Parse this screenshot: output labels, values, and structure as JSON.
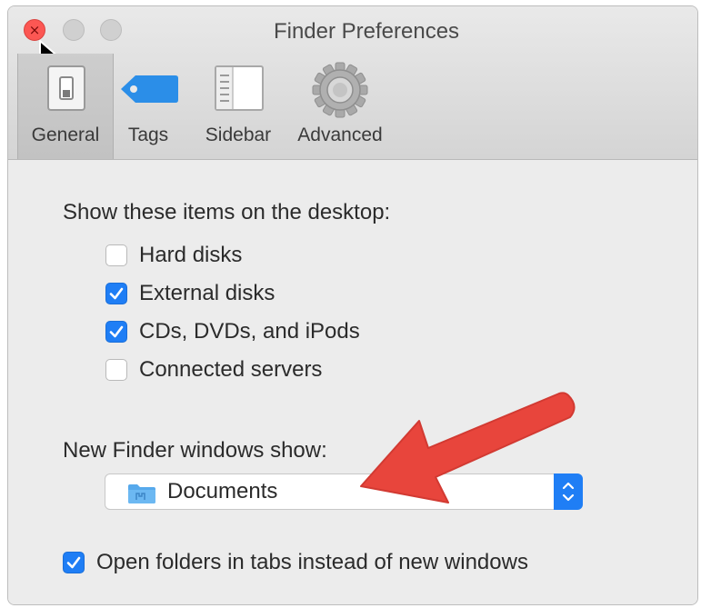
{
  "window": {
    "title": "Finder Preferences"
  },
  "toolbar": {
    "tabs": [
      {
        "label": "General",
        "icon": "switch-icon",
        "selected": true
      },
      {
        "label": "Tags",
        "icon": "tag-icon",
        "selected": false
      },
      {
        "label": "Sidebar",
        "icon": "sidebar-icon",
        "selected": false
      },
      {
        "label": "Advanced",
        "icon": "gear-icon",
        "selected": false
      }
    ]
  },
  "desktop": {
    "heading": "Show these items on the desktop:",
    "items": [
      {
        "label": "Hard disks",
        "checked": false
      },
      {
        "label": "External disks",
        "checked": true
      },
      {
        "label": "CDs, DVDs, and iPods",
        "checked": true
      },
      {
        "label": "Connected servers",
        "checked": false
      }
    ]
  },
  "new_window": {
    "heading": "New Finder windows show:",
    "selected": "Documents",
    "icon": "folder-icon"
  },
  "tabs_option": {
    "label": "Open folders in tabs instead of new windows",
    "checked": true
  },
  "colors": {
    "accent": "#1f7ef5",
    "close": "#fc5753",
    "annotation_arrow": "#e8453c"
  }
}
